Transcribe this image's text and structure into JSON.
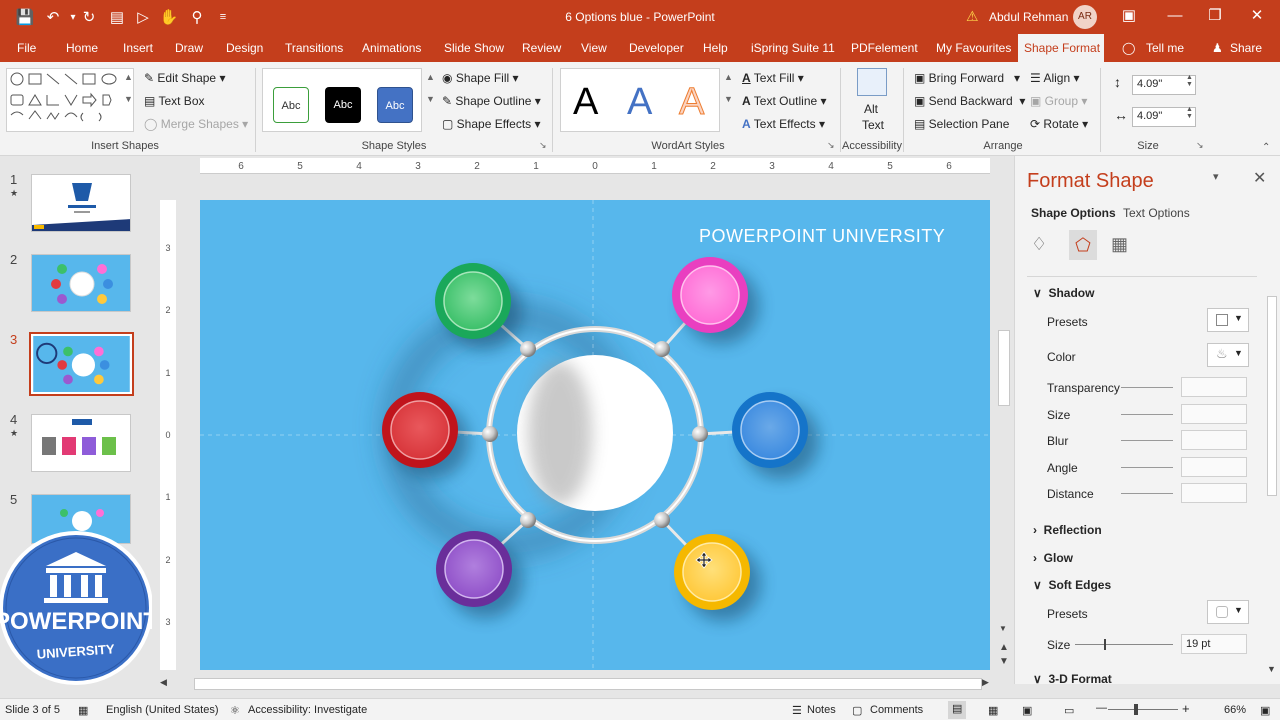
{
  "window": {
    "title": "6 Options blue  -  PowerPoint",
    "user_name": "Abdul Rehman",
    "user_initials": "AR"
  },
  "tabs": [
    "File",
    "Home",
    "Insert",
    "Draw",
    "Design",
    "Transitions",
    "Animations",
    "Slide Show",
    "Review",
    "View",
    "Developer",
    "Help",
    "iSpring Suite 11",
    "PDFelement",
    "My Favourites",
    "Shape Format",
    "Tell me",
    "Share"
  ],
  "ribbon": {
    "insert_shapes": {
      "label": "Insert Shapes",
      "edit_shape": "Edit Shape",
      "text_box": "Text Box",
      "merge_shapes": "Merge Shapes"
    },
    "shape_styles": {
      "label": "Shape Styles",
      "swatch": "Abc",
      "shape_fill": "Shape Fill",
      "shape_outline": "Shape Outline",
      "shape_effects": "Shape Effects"
    },
    "wordart": {
      "label": "WordArt Styles",
      "letter": "A",
      "text_fill": "Text Fill",
      "text_outline": "Text Outline",
      "text_effects": "Text Effects"
    },
    "accessibility": {
      "label": "Accessibility",
      "alt_text_1": "Alt",
      "alt_text_2": "Text"
    },
    "arrange": {
      "label": "Arrange",
      "bring_forward": "Bring Forward",
      "send_backward": "Send Backward",
      "selection_pane": "Selection Pane",
      "align": "Align",
      "group": "Group",
      "rotate": "Rotate"
    },
    "size": {
      "label": "Size",
      "height": "4.09\"",
      "width": "4.09\""
    }
  },
  "slides": [
    {
      "number": "1",
      "star": "★"
    },
    {
      "number": "2",
      "star": ""
    },
    {
      "number": "3",
      "star": ""
    },
    {
      "number": "4",
      "star": "★"
    },
    {
      "number": "5",
      "star": ""
    }
  ],
  "ruler": {
    "h_ticks": [
      "6",
      "5",
      "4",
      "3",
      "2",
      "1",
      "0",
      "1",
      "2",
      "3",
      "4",
      "5",
      "6"
    ],
    "v_ticks": [
      "3",
      "2",
      "1",
      "0",
      "1",
      "2",
      "3"
    ]
  },
  "slide": {
    "heading": "POWERPOINT UNIVERSITY",
    "circle_colors": {
      "green": "#1aa85a",
      "pink": "#e93fc0",
      "red": "#c0141c",
      "blue": "#1574c9",
      "purple": "#6a2e9a",
      "yellow": "#f5b800"
    }
  },
  "logo": {
    "line1": "POWERPOINT",
    "line2": "UNIVERSITY"
  },
  "format_pane": {
    "title": "Format Shape",
    "tab_shape": "Shape Options",
    "tab_text": "Text Options",
    "shadow": {
      "label": "Shadow",
      "presets": "Presets",
      "color": "Color",
      "transparency": "Transparency",
      "size": "Size",
      "blur": "Blur",
      "angle": "Angle",
      "distance": "Distance"
    },
    "reflection": "Reflection",
    "glow": "Glow",
    "soft_edges": {
      "label": "Soft Edges",
      "presets": "Presets",
      "size": "Size",
      "size_value": "19 pt",
      "size_fraction": 0.3
    },
    "threed": "3-D Format"
  },
  "status": {
    "slide": "Slide 3 of 5",
    "language": "English (United States)",
    "accessibility": "Accessibility: Investigate",
    "notes": "Notes",
    "comments": "Comments",
    "zoom": "66%"
  }
}
